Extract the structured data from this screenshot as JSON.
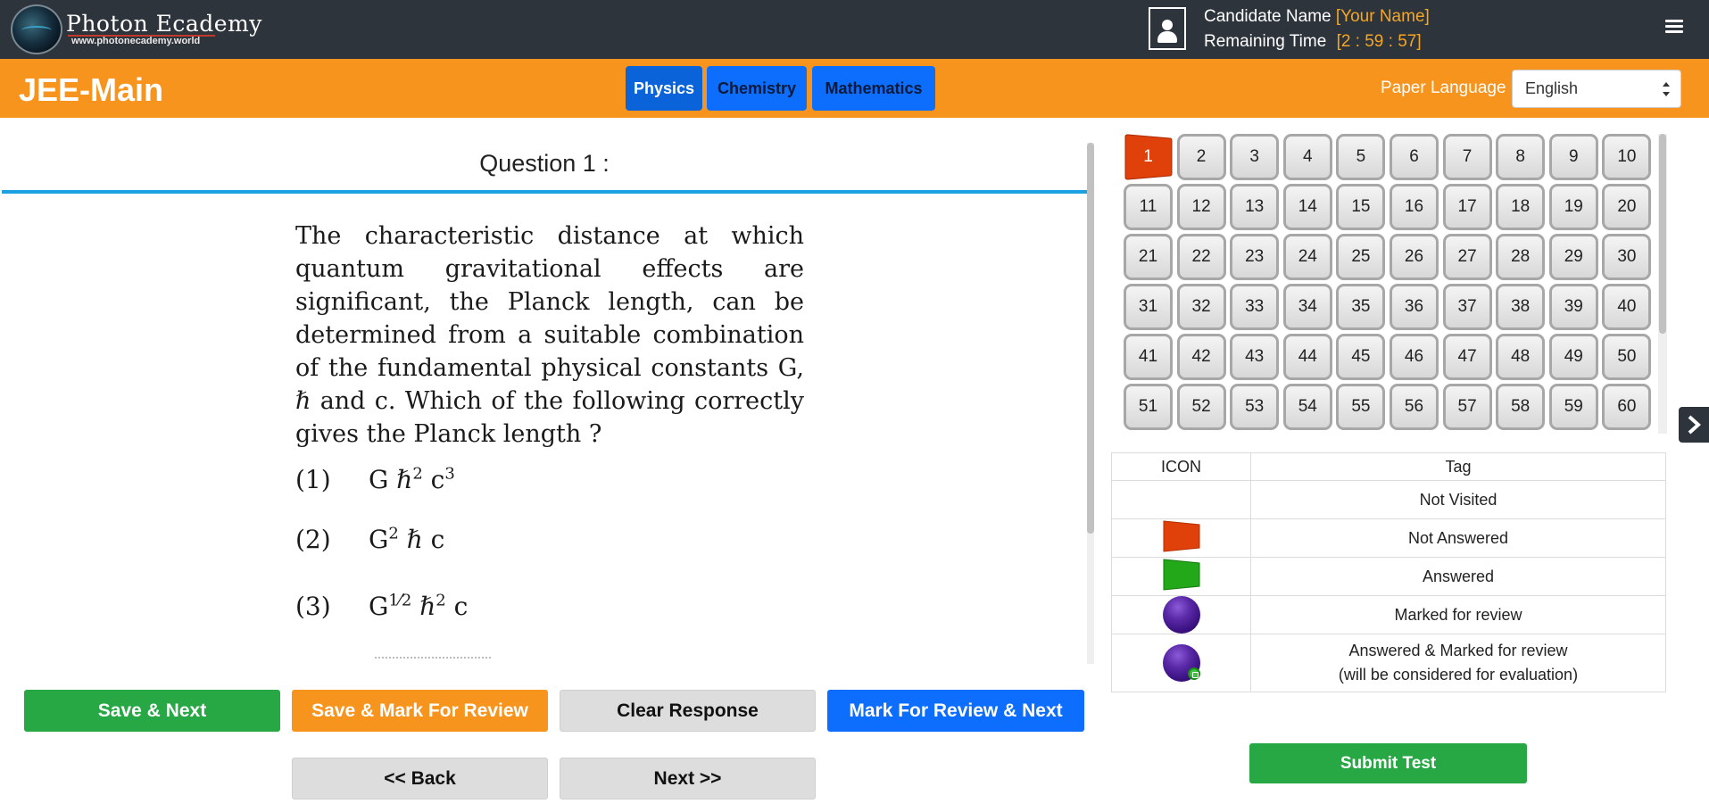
{
  "brand": {
    "name": "Photon Ecademy",
    "url": "www.photonecademy.world"
  },
  "candidate": {
    "name_label": "Candidate Name",
    "name_value": "[Your Name]",
    "time_label": "Remaining Time",
    "time_value": "[2 : 59 : 57]"
  },
  "exam": {
    "title": "JEE-Main"
  },
  "subjects": [
    {
      "label": "Physics",
      "active": true
    },
    {
      "label": "Chemistry",
      "active": false
    },
    {
      "label": "Mathematics",
      "active": false
    }
  ],
  "language": {
    "label": "Paper Language",
    "selected": "English"
  },
  "question": {
    "title": "Question 1 :",
    "text": "The characteristic distance at which quantum gravitational effects are significant, the Planck length, can be determined from a suitable combination of the fundamental physical constants G, ℏ and c. Which of the following correctly gives the Planck length ?",
    "options": [
      {
        "num": "(1)"
      },
      {
        "num": "(2)"
      },
      {
        "num": "(3)"
      }
    ]
  },
  "actions": {
    "save_next": "Save & Next",
    "save_mark": "Save & Mark For Review",
    "clear": "Clear Response",
    "mark_next": "Mark For Review & Next",
    "back": "<< Back",
    "next": "Next >>"
  },
  "palette": {
    "current": 1,
    "count": 60,
    "not_answered": [
      1
    ]
  },
  "legend": {
    "headers": {
      "icon": "ICON",
      "tag": "Tag"
    },
    "rows": [
      {
        "tag": "Not Visited"
      },
      {
        "tag": "Not Answered"
      },
      {
        "tag": "Answered"
      },
      {
        "tag": "Marked for review"
      },
      {
        "tag": "Answered & Marked for review",
        "note": "(will be considered for evaluation)"
      }
    ]
  },
  "submit_label": "Submit Test",
  "colors": {
    "topbar": "#2e343b",
    "orange": "#f7941d",
    "blue": "#0d6efd",
    "green": "#28a745",
    "not_answered": "#e0400a",
    "answered": "#22a818",
    "review": "#5a2aa8"
  }
}
